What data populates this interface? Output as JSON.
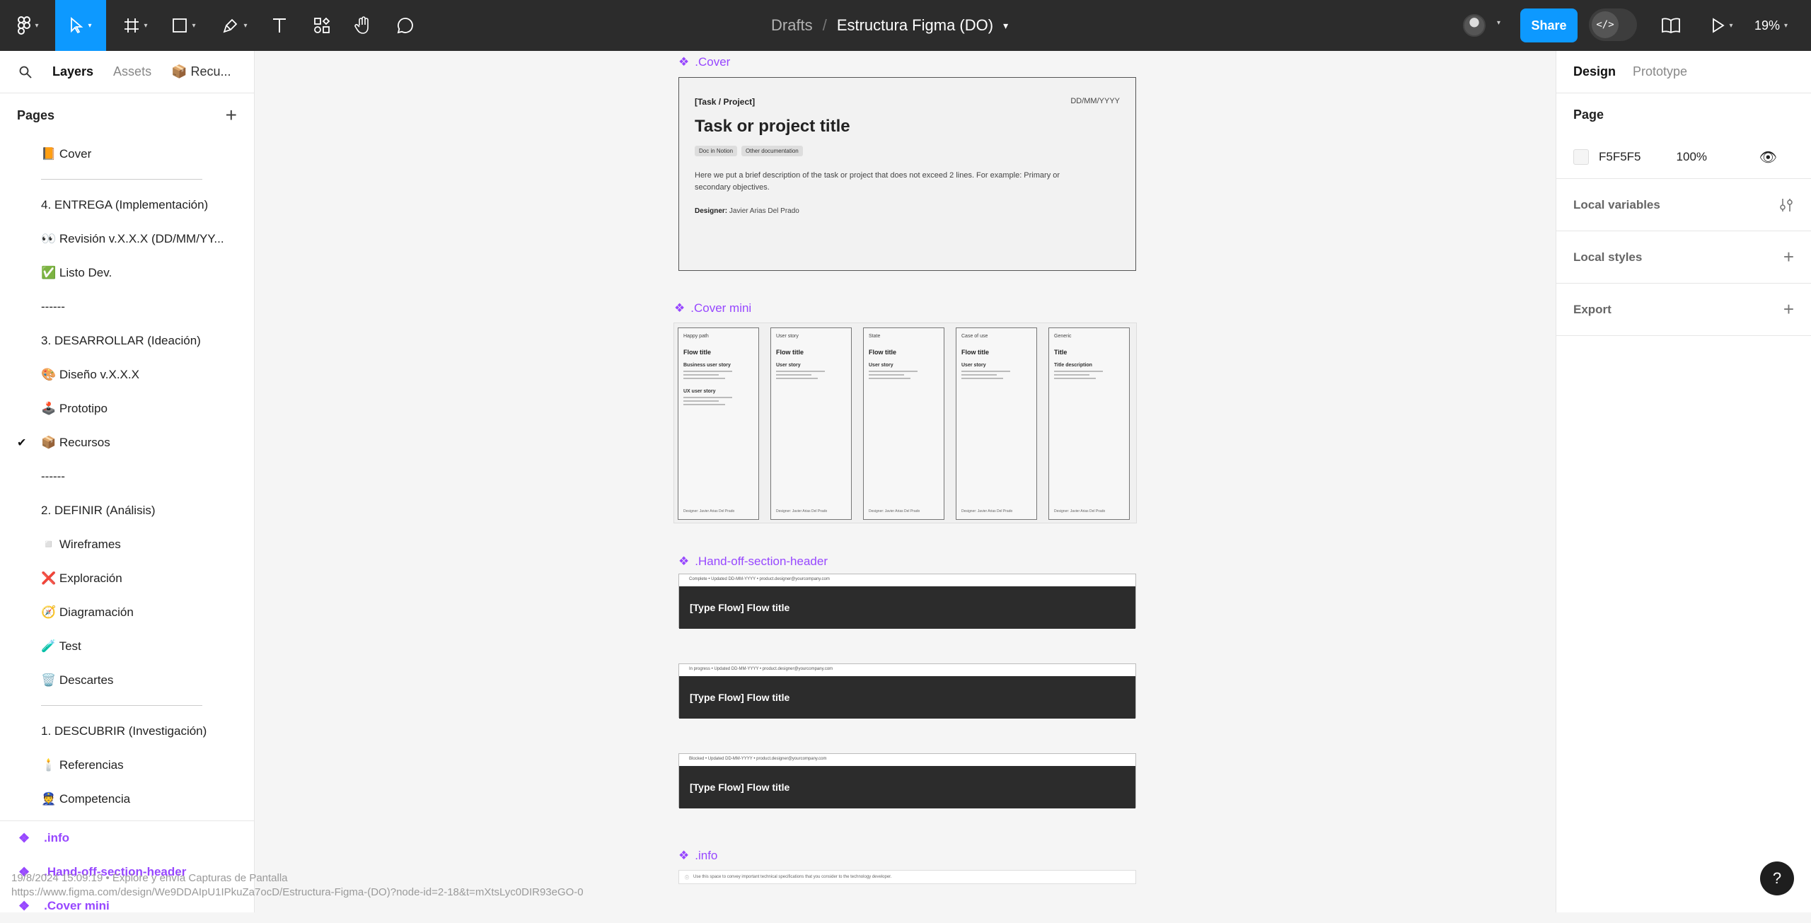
{
  "toolbar": {
    "file_path_drafts": "Drafts",
    "file_path_sep": "/",
    "file_name": "Estructura Figma (DO)",
    "share_label": "Share",
    "zoom": "19%"
  },
  "left_panel": {
    "tabs": {
      "layers": "Layers",
      "assets": "Assets",
      "current_page": "📦 Recu..."
    },
    "pages_heading": "Pages",
    "pages": [
      {
        "label": "📙 Cover",
        "selected": false
      },
      {
        "separator": true
      },
      {
        "label": "4. ENTREGA (Implementación)",
        "selected": false
      },
      {
        "label": "👀 Revisión v.X.X.X (DD/MM/YY...",
        "selected": false
      },
      {
        "label": "✅ Listo Dev.",
        "selected": false
      },
      {
        "label": "------",
        "selected": false
      },
      {
        "label": "3. DESARROLLAR (Ideación)",
        "selected": false
      },
      {
        "label": "🎨 Diseño v.X.X.X",
        "selected": false
      },
      {
        "label": "🕹️ Prototipo",
        "selected": false
      },
      {
        "label": "📦 Recursos",
        "selected": true
      },
      {
        "label": "------",
        "selected": false
      },
      {
        "label": "2. DEFINIR (Análisis)",
        "selected": false
      },
      {
        "label": "◽ Wireframes",
        "selected": false
      },
      {
        "label": "❌ Exploración",
        "selected": false
      },
      {
        "label": "🧭 Diagramación",
        "selected": false
      },
      {
        "label": "🧪 Test",
        "selected": false
      },
      {
        "label": "🗑️ Descartes",
        "selected": false
      },
      {
        "separator": true
      },
      {
        "label": "1. DESCUBRIR (Investigación)",
        "selected": false
      },
      {
        "label": "🕯️ Referencias",
        "selected": false
      },
      {
        "label": "👮 Competencia",
        "selected": false
      }
    ],
    "components": [
      {
        "label": ".info"
      },
      {
        "label": ".Hand-off-section-header"
      },
      {
        "label": ".Cover mini"
      }
    ]
  },
  "right_panel": {
    "tabs": {
      "design": "Design",
      "prototype": "Prototype"
    },
    "page_heading": "Page",
    "fill_hex": "F5F5F5",
    "fill_opacity": "100%",
    "rows": [
      "Local variables",
      "Local styles",
      "Export"
    ],
    "help": "?"
  },
  "canvas": {
    "cover_label": ".Cover",
    "cover": {
      "tag": "[Task / Project]",
      "date": "DD/MM/YYYY",
      "title": "Task or project title",
      "chips": [
        "Doc in Notion",
        "Other documentation"
      ],
      "description": "Here we put a brief description of the task or project that does not exceed 2 lines. For example: Primary or secondary objectives.",
      "designer_label": "Designer:",
      "designer_name": "Javier Arias Del Prado"
    },
    "cover_mini_label": ".Cover mini",
    "minis": [
      {
        "type": "Happy path",
        "title": "Flow title",
        "sub1": "Business user story",
        "sub2": "UX user story",
        "footer": "Designer: Javier Arias Del Prado"
      },
      {
        "type": "User story",
        "title": "Flow title",
        "sub1": "User story",
        "sub2": "",
        "footer": "Designer: Javier Arias Del Prado"
      },
      {
        "type": "State",
        "title": "Flow title",
        "sub1": "User story",
        "sub2": "",
        "footer": "Designer: Javier Arias Del Prado"
      },
      {
        "type": "Case of use",
        "title": "Flow title",
        "sub1": "User story",
        "sub2": "",
        "footer": "Designer: Javier Arias Del Prado"
      },
      {
        "type": "Generic",
        "title": "Title",
        "sub1": "Title description",
        "sub2": "",
        "footer": "Designer: Javier Arias Del Prado"
      }
    ],
    "hos_label": ".Hand-off-section-header",
    "hos": [
      {
        "meta": "Complete • Updated DD-MM-YYYY • product.designer@yourcompany.com",
        "title": "[Type Flow] Flow title"
      },
      {
        "meta": "In progress • Updated DD-MM-YYYY • product.designer@yourcompany.com",
        "title": "[Type Flow] Flow title"
      },
      {
        "meta": "Blocked • Updated DD-MM-YYYY • product.designer@yourcompany.com",
        "title": "[Type Flow] Flow title"
      }
    ],
    "info_label": ".info",
    "info_text": "Use this space to convey important technical specifications that you consider to the technology developer."
  },
  "watermark": {
    "line1": "19/8/2024 15:09:19 • Explore y envía Capturas de Pantalla",
    "line2": "https://www.figma.com/design/We9DDAIpU1IPkuZa7ocD/Estructura-Figma-(DO)?node-id=2-18&t=mXtsLyc0DIR93eGO-0"
  },
  "colors": {
    "accent": "#0D99FF",
    "component": "#9747FF",
    "toolbar": "#2C2C2C",
    "canvas": "#F5F5F5"
  }
}
